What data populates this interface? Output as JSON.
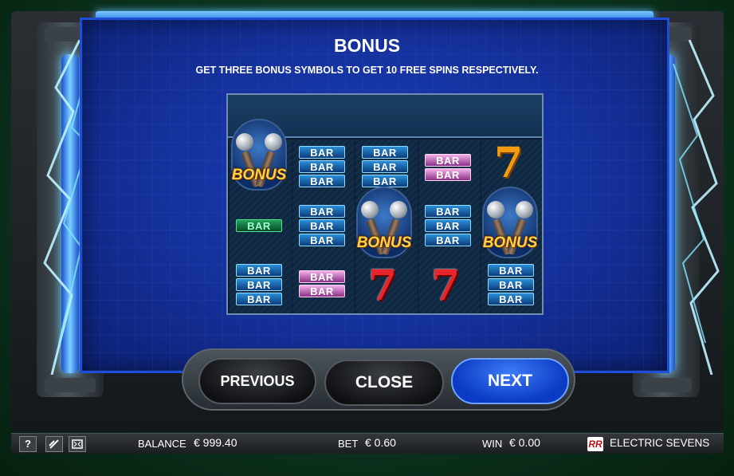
{
  "popup": {
    "title": "BONUS",
    "subtitle": "GET THREE BONUS SYMBOLS TO GET 10 FREE SPINS RESPECTIVELY."
  },
  "reels": {
    "bar_label": "BAR",
    "bonus_label": "BONUS",
    "seven_label": "7",
    "columns": [
      {
        "symbols": [
          "bonus",
          "green-bar",
          "triple-bar"
        ]
      },
      {
        "symbols": [
          "triple-bar",
          "triple-bar",
          "double-pink-bar"
        ]
      },
      {
        "symbols": [
          "triple-bar",
          "bonus",
          "seven"
        ]
      },
      {
        "symbols": [
          "double-pink-bar",
          "triple-bar",
          "seven"
        ]
      },
      {
        "symbols": [
          "gold-seven",
          "bonus",
          "triple-bar"
        ]
      }
    ]
  },
  "buttons": {
    "previous": "PREVIOUS",
    "close": "CLOSE",
    "next": "NEXT"
  },
  "status_bar": {
    "help_icon": "?",
    "balance_label": "BALANCE",
    "balance_value": "€ 999.40",
    "bet_label": "BET",
    "bet_value": "€ 0.60",
    "win_label": "WIN",
    "win_value": "€ 0.00",
    "logo_text": "RR",
    "game_name": "ELECTRIC SEVENS"
  },
  "colors": {
    "panel_blue": "#14309a",
    "next_button": "#0b3ac4",
    "seven_red": "#e8252a",
    "bonus_gold": "#ffd24a"
  }
}
